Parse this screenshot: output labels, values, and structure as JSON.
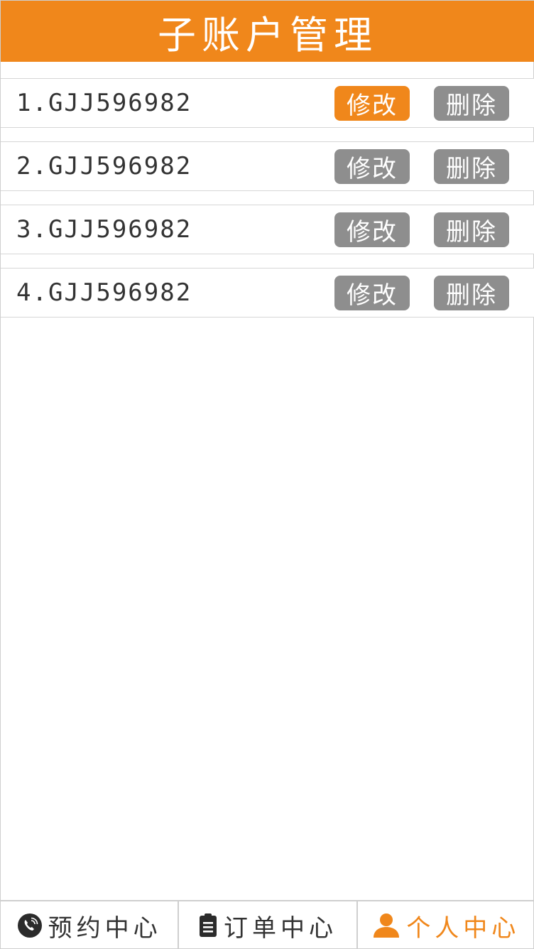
{
  "header": {
    "title": "子账户管理"
  },
  "accounts": [
    {
      "label": "1.GJJ596982",
      "edit_label": "修改",
      "delete_label": "删除",
      "edit_active": true
    },
    {
      "label": "2.GJJ596982",
      "edit_label": "修改",
      "delete_label": "删除",
      "edit_active": false
    },
    {
      "label": "3.GJJ596982",
      "edit_label": "修改",
      "delete_label": "删除",
      "edit_active": false
    },
    {
      "label": "4.GJJ596982",
      "edit_label": "修改",
      "delete_label": "删除",
      "edit_active": false
    }
  ],
  "tabbar": {
    "items": [
      {
        "label": "预约中心",
        "icon": "phone-icon",
        "active": false
      },
      {
        "label": "订单中心",
        "icon": "clipboard-icon",
        "active": false
      },
      {
        "label": "个人中心",
        "icon": "user-icon",
        "active": true
      }
    ]
  },
  "colors": {
    "accent": "#f0871b",
    "button_gray": "#8e8e8e",
    "text_dark": "#333333",
    "border": "#d6d6d6"
  }
}
